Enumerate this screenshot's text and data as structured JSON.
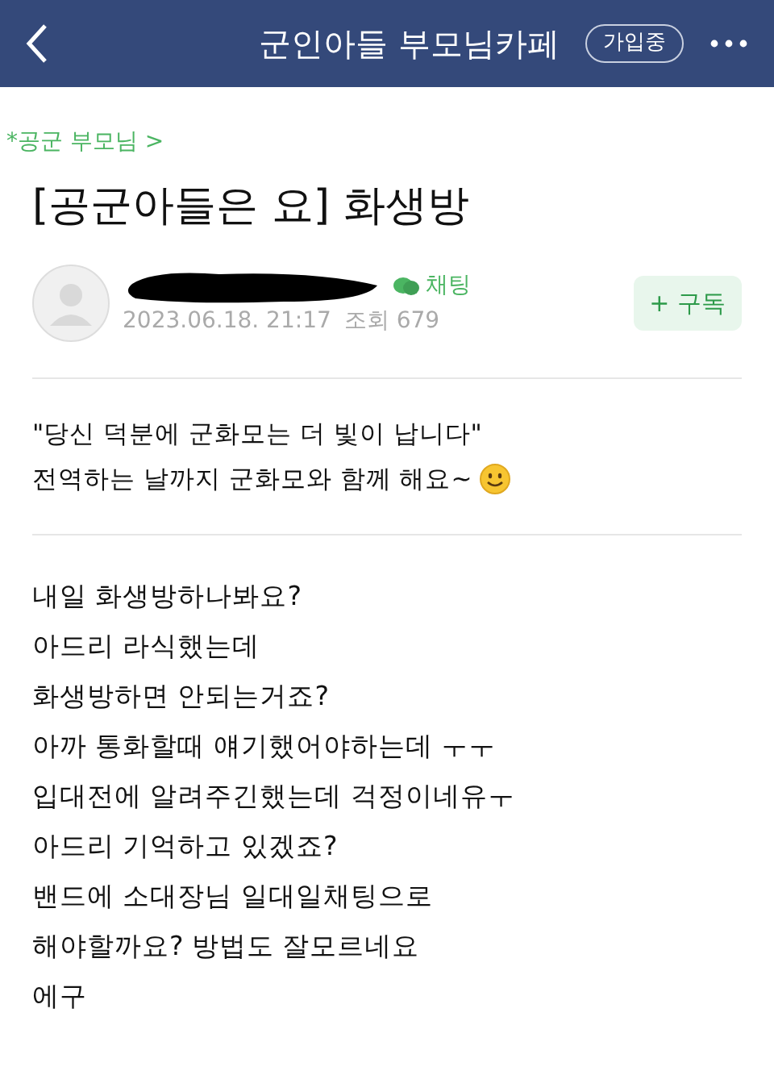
{
  "header": {
    "title": "군인아들 부모님카페",
    "join_badge": "가입중"
  },
  "category": "*공군 부모님 >",
  "post_title": "[공군아들은 요] 화생방",
  "author": {
    "chat_label": "채팅",
    "date": "2023.06.18. 21:17",
    "views": "조회 679",
    "subscribe": "+ 구독"
  },
  "quote_lines": [
    "\"당신 덕분에 군화모는 더 빛이 납니다\"",
    "전역하는 날까지 군화모와 함께 해요~"
  ],
  "body_lines": [
    "내일 화생방하나봐요?",
    "아드리 라식했는데",
    "화생방하면 안되는거죠?",
    "아까 통화할때 얘기했어야하는데 ㅜㅜ",
    "입대전에 알려주긴했는데 걱정이네유ㅜ",
    "아드리 기억하고 있겠죠?",
    "밴드에 소대장님 일대일채팅으로",
    "해야할까요? 방법도 잘모르네요",
    "에구"
  ]
}
